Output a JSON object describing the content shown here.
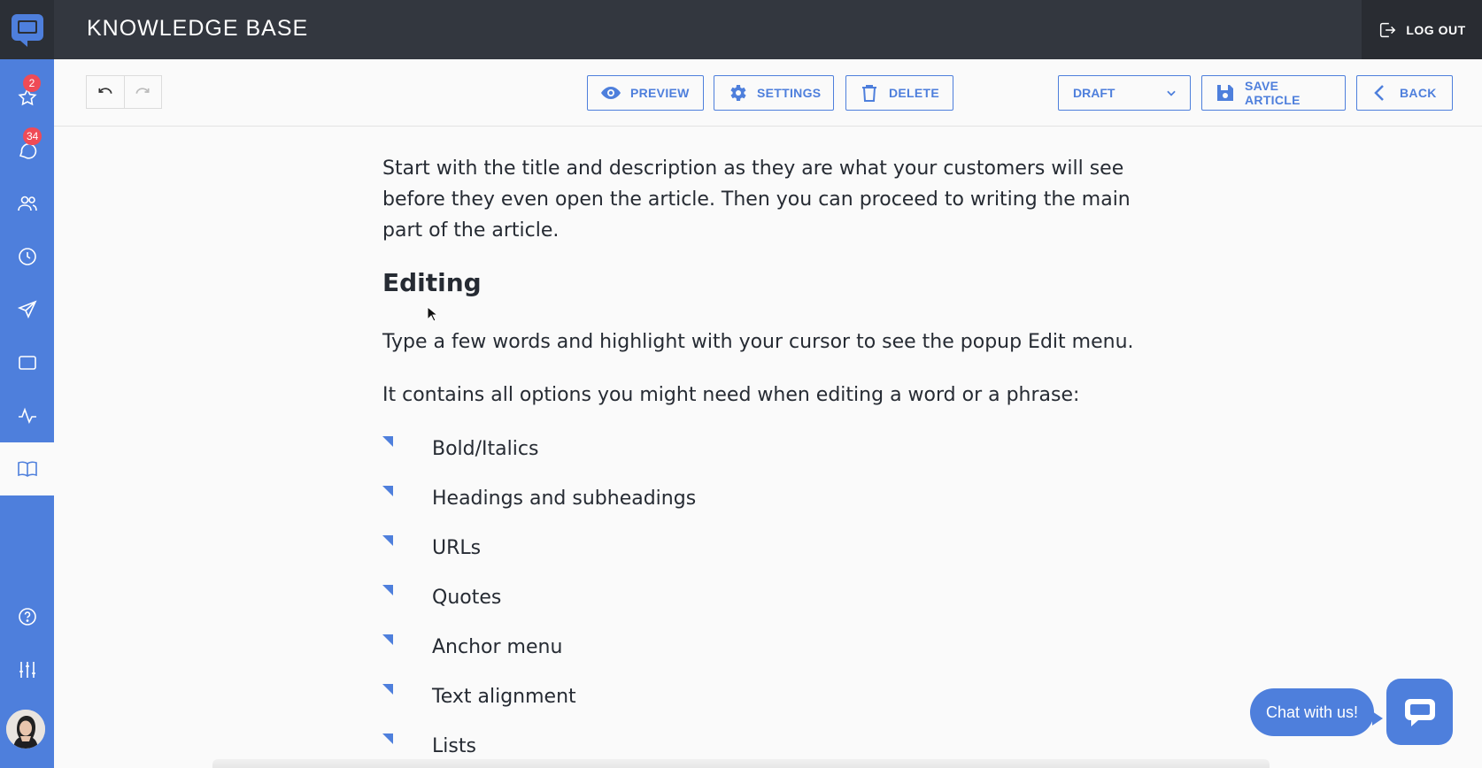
{
  "app": {
    "title": "KNOWLEDGE BASE",
    "logout_label": "LOG OUT",
    "accent": "#4e7fdc"
  },
  "sidebar": {
    "items": [
      {
        "name": "starred",
        "icon": "star-icon",
        "badge": "2"
      },
      {
        "name": "chats",
        "icon": "chat-icon",
        "badge": "34"
      },
      {
        "name": "customers",
        "icon": "users-icon",
        "badge": ""
      },
      {
        "name": "history",
        "icon": "clock-icon",
        "badge": ""
      },
      {
        "name": "campaigns",
        "icon": "send-icon",
        "badge": ""
      },
      {
        "name": "widget",
        "icon": "window-icon",
        "badge": ""
      },
      {
        "name": "reports",
        "icon": "activity-icon",
        "badge": ""
      },
      {
        "name": "knowledge-base",
        "icon": "book-icon",
        "badge": "",
        "active": true
      },
      {
        "name": "help",
        "icon": "help-icon",
        "badge": ""
      },
      {
        "name": "settings",
        "icon": "sliders-icon",
        "badge": ""
      }
    ]
  },
  "toolbar": {
    "preview_label": "PREVIEW",
    "settings_label": "SETTINGS",
    "delete_label": "DELETE",
    "status_value": "DRAFT",
    "save_label": "SAVE ARTICLE",
    "back_label": "BACK"
  },
  "article": {
    "intro": "Start with the title and description as they are what your customers will see before they even open the article. Then you can proceed to writing the main part of the article.",
    "heading": "Editing",
    "p_highlight": "Type a few words and highlight with your cursor to see the popup Edit menu.",
    "p_options": "It contains all options you might need when editing a word or a phrase:",
    "list": [
      "Bold/Italics",
      "Headings and subheadings",
      "URLs",
      "Quotes",
      "Anchor menu",
      "Text alignment",
      "Lists"
    ]
  },
  "chat": {
    "bubble_label": "Chat with us!"
  }
}
